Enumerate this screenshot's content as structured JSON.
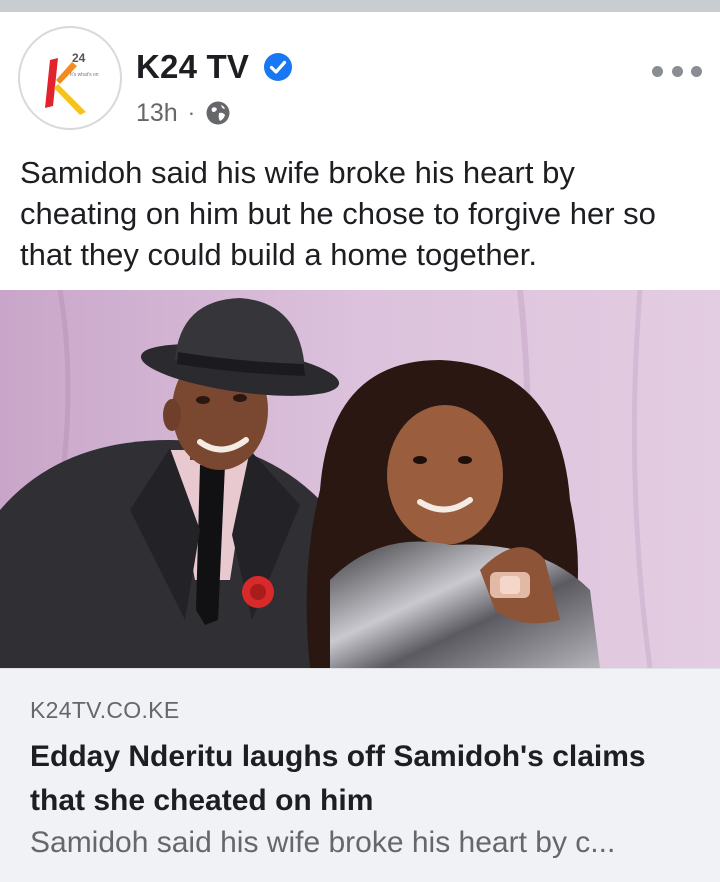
{
  "post": {
    "page_name": "K24 TV",
    "verified_icon": "verified-badge-icon",
    "timestamp": "13h",
    "separator": "·",
    "audience_icon": "globe-icon",
    "more_icon": "more-options-icon",
    "caption": "Samidoh said his wife broke his heart by cheating on him but he chose to forgive her so that they could build a home together."
  },
  "avatar": {
    "logo_text": "24",
    "tagline": "It's what's on"
  },
  "photo": {
    "description_icon": "post-photo"
  },
  "link_preview": {
    "domain": "K24TV.CO.KE",
    "title": "Edday Nderitu laughs off Samidoh's claims that she cheated on him",
    "description": "Samidoh said his wife broke his heart by c..."
  },
  "colors": {
    "verified": "#1877f2",
    "secondary_text": "#65676b",
    "primary_text": "#1c1e21",
    "card_bg": "#f0f2f5"
  }
}
